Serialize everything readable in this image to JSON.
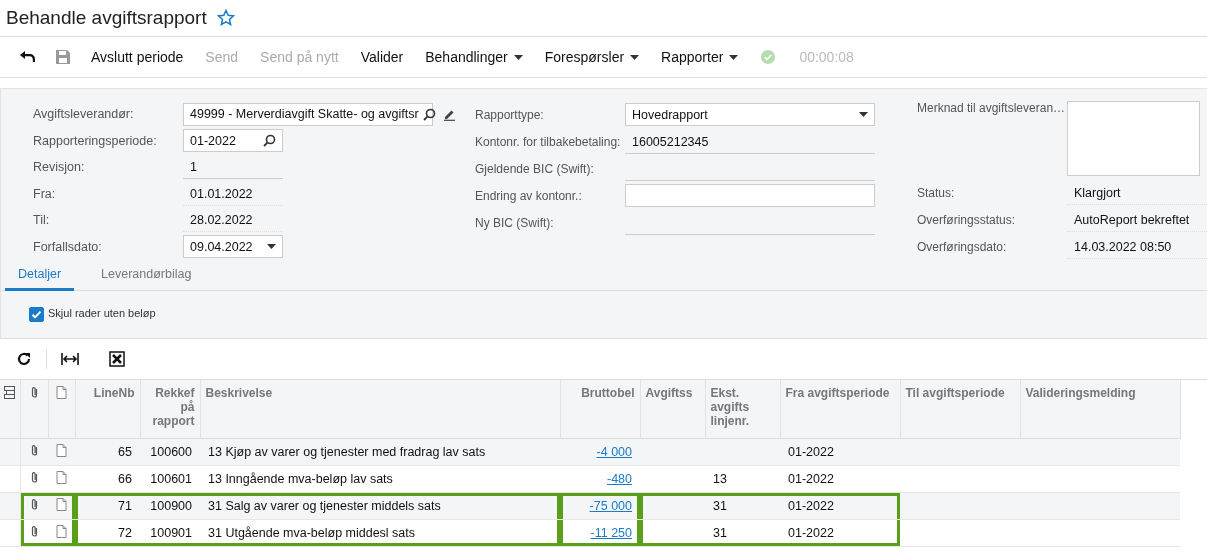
{
  "page_title": "Behandle avgiftsrapport",
  "favorite": false,
  "toolbar": [
    {
      "kind": "undo",
      "disabled": false
    },
    {
      "kind": "save",
      "disabled": true
    },
    {
      "kind": "button",
      "label": "Avslutt periode",
      "disabled": false
    },
    {
      "kind": "button",
      "label": "Send",
      "disabled": true
    },
    {
      "kind": "button",
      "label": "Send på nytt",
      "disabled": true
    },
    {
      "kind": "button",
      "label": "Valider",
      "disabled": false
    },
    {
      "kind": "menu",
      "label": "Behandlinger",
      "disabled": false
    },
    {
      "kind": "menu",
      "label": "Forespørsler",
      "disabled": false
    },
    {
      "kind": "menu",
      "label": "Rapporter",
      "disabled": false
    },
    {
      "kind": "status",
      "disabled": true
    },
    {
      "kind": "timer",
      "label": "00:00:08",
      "disabled": true
    }
  ],
  "form": {
    "columns": [
      [
        {
          "label": "Avgiftsleverandør:",
          "kind": "lookup-edit",
          "value": "49999 - Merverdiavgift Skatte- og avgiftsr"
        },
        {
          "label": "Rapporteringsperiode:",
          "kind": "lookup",
          "value": "01-2022"
        },
        {
          "label": "Revisjon:",
          "kind": "readonly",
          "value": "1"
        },
        {
          "label": "Fra:",
          "kind": "plain",
          "value": "01.01.2022"
        },
        {
          "label": "Til:",
          "kind": "plain",
          "value": "28.02.2022"
        },
        {
          "label": "Forfallsdato:",
          "kind": "dropdown",
          "value": "09.04.2022"
        }
      ],
      [
        {
          "label": "Rapporttype:",
          "kind": "dropdown",
          "value": "Hovedrapport"
        },
        {
          "label": "Kontonr. for tilbakebetaling:",
          "kind": "readonly",
          "value": "16005212345"
        },
        {
          "label": "Gjeldende BIC (Swift):",
          "kind": "readonly"
        },
        {
          "label": "Endring av kontonr.:",
          "kind": "input"
        },
        {
          "label": "Ny BIC (Swift):",
          "kind": "readonly"
        }
      ],
      [
        {
          "label": "Merknad til avgiftsleveran…",
          "kind": "textarea"
        },
        {
          "label": "Status:",
          "kind": "plain",
          "value": "Klargjort"
        },
        {
          "label": "Overføringsstatus:",
          "kind": "plain",
          "value": "AutoReport bekreftet"
        },
        {
          "label": "Overføringsdato:",
          "kind": "plain",
          "value": "14.03.2022 08:50"
        }
      ]
    ]
  },
  "tabs": [
    {
      "label": "Detaljer",
      "selected": true
    },
    {
      "label": "Leverandørbilag",
      "selected": false
    }
  ],
  "filter": {
    "label": "Skjul rader uten beløp",
    "checked": true
  },
  "table": {
    "columns": [
      "LineNb",
      "Rekkef på rapport",
      "Beskrivelse",
      "Bruttobel",
      "Avgiftss",
      "Ekst. avgifts linjenr.",
      "Fra avgiftsperiode",
      "Til avgiftsperiode",
      "Valideringsmelding"
    ],
    "rows": [
      {
        "line_nb": "65",
        "order": "100600",
        "description": "13 Kjøp av varer og tjenester med fradrag lav sats",
        "gross": "-4 000",
        "from_period": "01-2022",
        "highlighted": false
      },
      {
        "line_nb": "66",
        "order": "100601",
        "description": "13 Inngående mva-beløp lav sats",
        "gross": "-480",
        "ext_line": "13",
        "from_period": "01-2022",
        "highlighted": false
      },
      {
        "line_nb": "71",
        "order": "100900",
        "description": "31 Salg av varer og tjenester middels sats",
        "gross": "-75 000",
        "ext_line": "31",
        "from_period": "01-2022",
        "highlighted": true
      },
      {
        "line_nb": "72",
        "order": "100901",
        "description": "31 Utgående mva-beløp middesl sats",
        "gross": "-11 250",
        "ext_line": "31",
        "from_period": "01-2022",
        "highlighted": true
      }
    ]
  }
}
